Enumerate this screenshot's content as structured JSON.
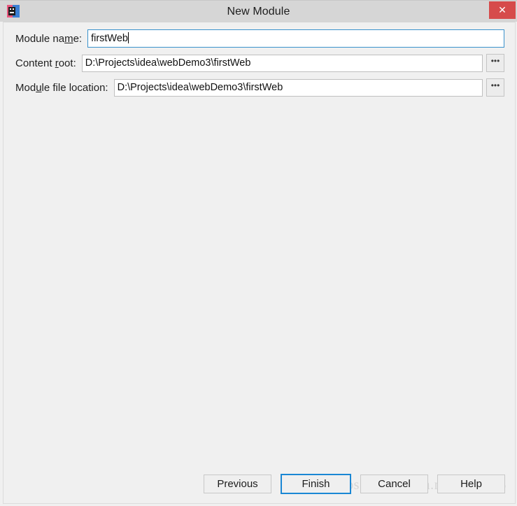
{
  "window": {
    "title": "New Module",
    "icon": "intellij-idea-icon",
    "close_label": "✕"
  },
  "form": {
    "rows": [
      {
        "label_before": "Module na",
        "label_mnemonic": "m",
        "label_after": "e:",
        "value": "firstWeb",
        "focused": true,
        "has_browse": false,
        "browse_label": ""
      },
      {
        "label_before": "Content ",
        "label_mnemonic": "r",
        "label_after": "oot:",
        "value": "D:\\Projects\\idea\\webDemo3\\firstWeb",
        "focused": false,
        "has_browse": true,
        "browse_label": "•••"
      },
      {
        "label_before": "Mod",
        "label_mnemonic": "u",
        "label_after": "le file location:",
        "value": "D:\\Projects\\idea\\webDemo3\\firstWeb",
        "focused": false,
        "has_browse": true,
        "browse_label": "•••"
      }
    ]
  },
  "footer": {
    "buttons": [
      {
        "label": "Previous",
        "default": false
      },
      {
        "label": "Finish",
        "default": true
      },
      {
        "label": "Cancel",
        "default": false
      },
      {
        "label": "Help",
        "default": false
      }
    ]
  },
  "watermark": {
    "text": "https://blog.csdn.net/skye_95"
  },
  "colors": {
    "titlebar": "#d6d6d6",
    "content_bg": "#f0f0f0",
    "close_red": "#d64b4b",
    "focus_blue": "#3a92cc",
    "default_button_blue": "#1a87d4"
  }
}
